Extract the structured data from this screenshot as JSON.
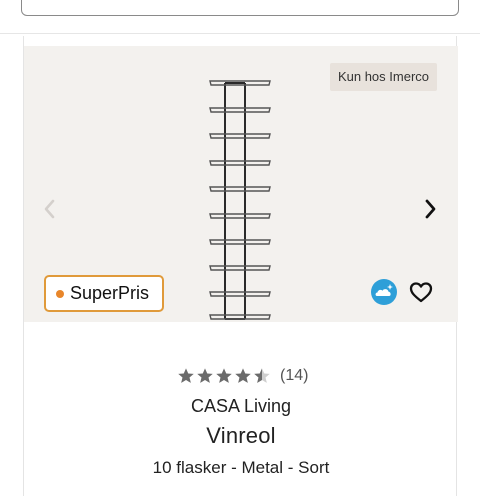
{
  "header": {
    "search": {
      "placeholder": ""
    }
  },
  "product": {
    "exclusive_badge": "Kun hos Imerco",
    "price_badge": "SuperPris",
    "rating": {
      "stars": 4.5,
      "max": 5,
      "count_label": "(14)"
    },
    "brand": "CASA Living",
    "title": "Vinreol",
    "specs": "10 flasker - Metal - Sort"
  },
  "icons": {
    "prev": "chevron-left-icon",
    "next": "chevron-right-icon",
    "eco": "eco-cloud-icon",
    "wishlist": "heart-icon"
  },
  "colors": {
    "price_badge_border": "#e09a3a",
    "price_badge_dot": "#e8862a",
    "eco_blue": "#2e9fd8",
    "image_background": "#f3f1ee",
    "star": "#6b6b6b"
  }
}
